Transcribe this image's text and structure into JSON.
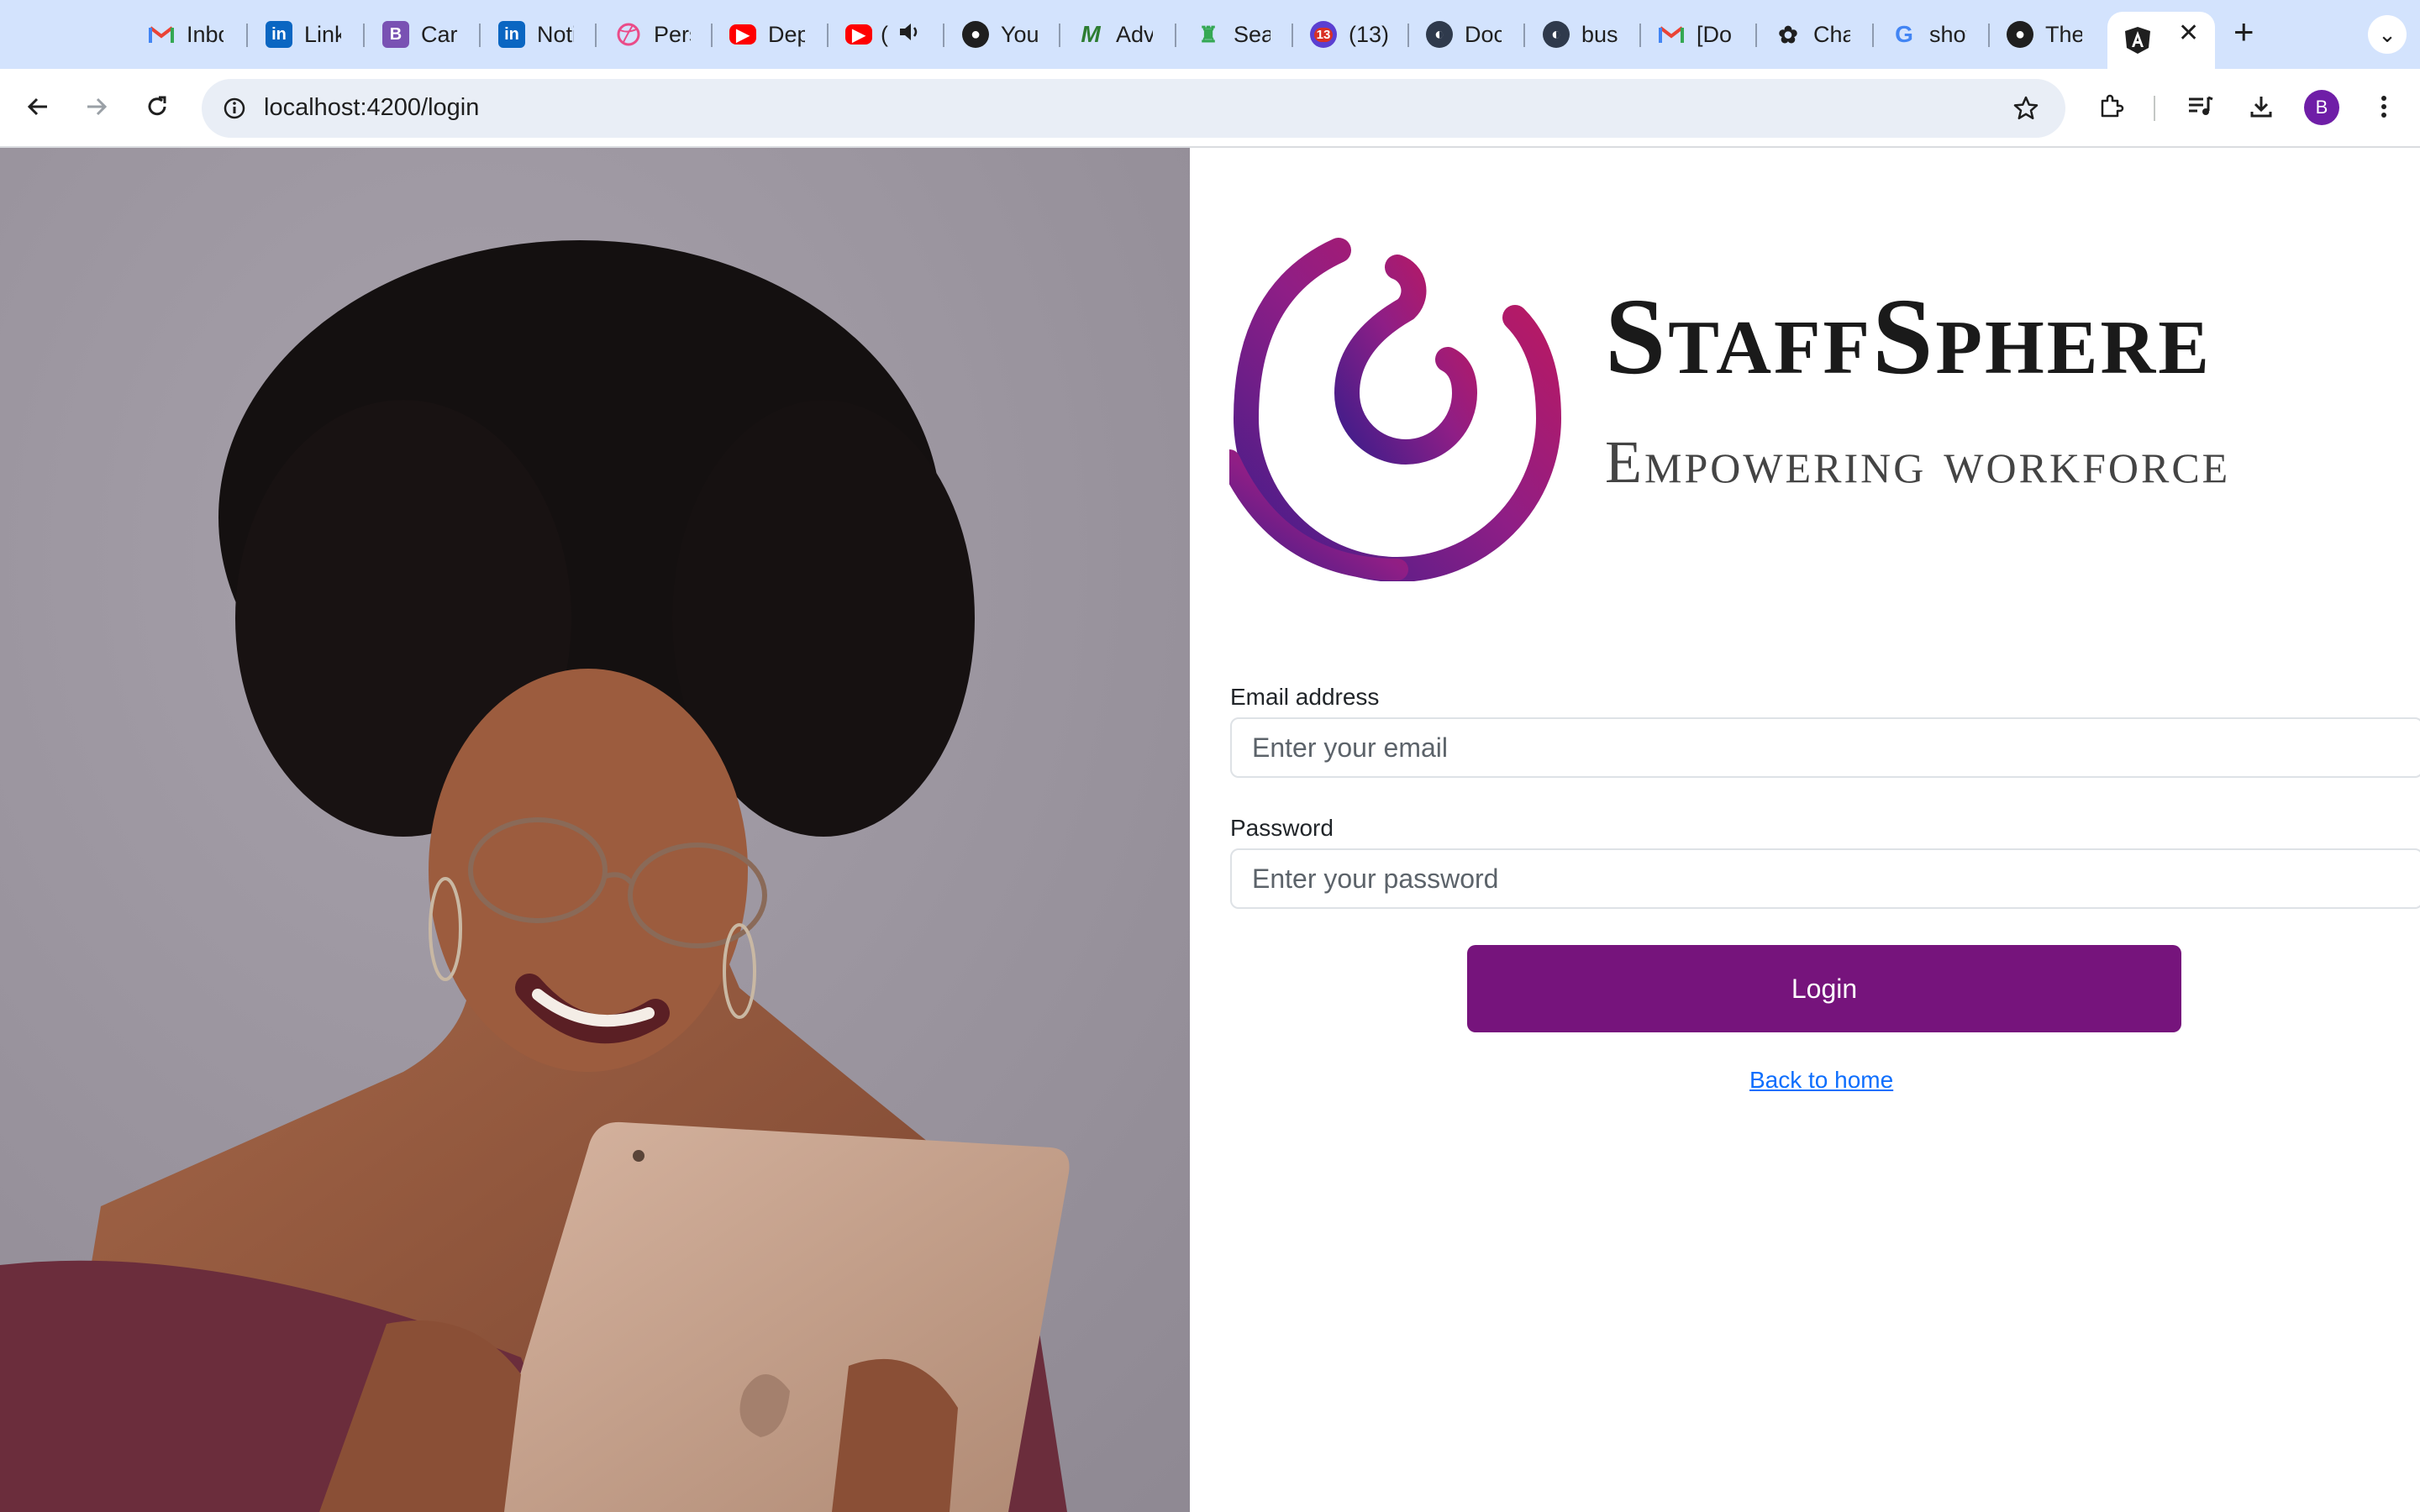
{
  "browser": {
    "tabs": [
      {
        "title": "Inbox",
        "favicon": "gmail-icon",
        "color": "#ea4335"
      },
      {
        "title": "LinkedIn",
        "favicon": "linkedin-icon",
        "color": "#0a66c2"
      },
      {
        "title": "Cards",
        "favicon": "bootstrap-icon",
        "color": "#7952b3"
      },
      {
        "title": "Notifications",
        "favicon": "linkedin-icon",
        "color": "#0a66c2"
      },
      {
        "title": "Personal",
        "favicon": "dribbble-icon",
        "color": "#ea4c89"
      },
      {
        "title": "Deploy",
        "favicon": "youtube-icon",
        "color": "#ff0000"
      },
      {
        "title": "(",
        "favicon": "youtube-icon",
        "color": "#ff0000"
      },
      {
        "title": "Your",
        "favicon": "github-icon",
        "color": "#1f1f1f"
      },
      {
        "title": "Advanced",
        "favicon": "m-logo-icon",
        "color": "#2e7d32"
      },
      {
        "title": "Search",
        "favicon": "android-icon",
        "color": "#34a853"
      },
      {
        "title": "(13)",
        "favicon": "notification-icon",
        "color": "#d93025",
        "badge": "13"
      },
      {
        "title": "Docs",
        "favicon": "docker-icon",
        "color": "#2f3a4c"
      },
      {
        "title": "business",
        "favicon": "docker-icon",
        "color": "#2f3a4c"
      },
      {
        "title": "[Do",
        "favicon": "gmail-icon",
        "color": "#ea4335"
      },
      {
        "title": "ChatGPT",
        "favicon": "openai-icon",
        "color": "#1f1f1f"
      },
      {
        "title": "show",
        "favicon": "google-icon",
        "color": "#4285f4"
      },
      {
        "title": "The",
        "favicon": "github-icon",
        "color": "#1f1f1f"
      },
      {
        "title": "",
        "favicon": "angular-icon",
        "color": "#1f1f1f",
        "active": true
      }
    ],
    "url": "localhost:4200/login",
    "profile_initial": "B",
    "profile_color": "#6f1ea7"
  },
  "brand": {
    "name": "StaffSphere",
    "tagline": "Empowering workforce",
    "gradient_start": "#c2185b",
    "gradient_end": "#3f1d8a"
  },
  "form": {
    "email_label": "Email address",
    "email_placeholder": "Enter your email",
    "email_value": "",
    "password_label": "Password",
    "password_placeholder": "Enter your password",
    "password_value": "",
    "login_label": "Login",
    "back_link": "Back to home",
    "button_color": "#76147c"
  }
}
